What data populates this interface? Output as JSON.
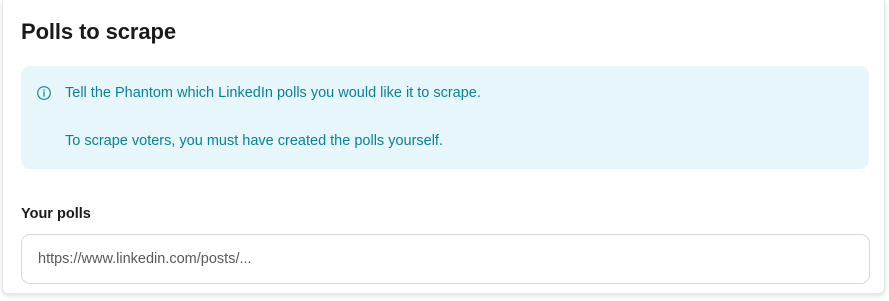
{
  "section": {
    "title": "Polls to scrape"
  },
  "info": {
    "icon": "info-circle-icon",
    "color": "#0b7f99",
    "background": "#e6f6fb",
    "line1": "Tell the Phantom which LinkedIn polls you would like it to scrape.",
    "line2": "To scrape voters, you must have created the polls yourself."
  },
  "polls_field": {
    "label": "Your polls",
    "value": "",
    "placeholder": "https://www.linkedin.com/posts/..."
  }
}
